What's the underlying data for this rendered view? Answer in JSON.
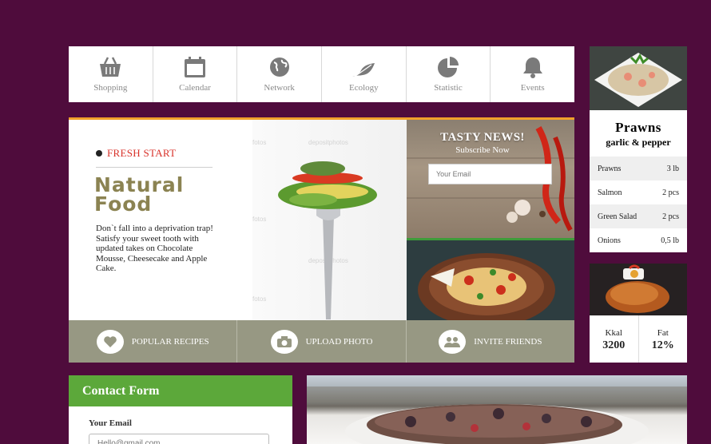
{
  "nav": {
    "items": [
      {
        "label": "Shopping",
        "icon": "basket-icon"
      },
      {
        "label": "Calendar",
        "icon": "calendar-icon"
      },
      {
        "label": "Network",
        "icon": "globe-icon"
      },
      {
        "label": "Ecology",
        "icon": "leaf-icon"
      },
      {
        "label": "Statistic",
        "icon": "pie-chart-icon"
      },
      {
        "label": "Events",
        "icon": "bell-icon"
      }
    ]
  },
  "hero": {
    "kicker": "FRESH START",
    "title_line1": "Natural",
    "title_line2": "Food",
    "description": "Don`t fall into a deprivation trap! Satisfy your sweet tooth with updated takes on Chocolate Mousse, Cheesecake and Apple Cake.",
    "watermarks": [
      "fotos",
      "depositphotos"
    ]
  },
  "subscribe": {
    "title": "TASTY NEWS!",
    "subtitle": "Subscribe Now",
    "placeholder": "Your Email"
  },
  "actions": [
    {
      "label": "POPULAR RECIPES",
      "icon": "heart-icon"
    },
    {
      "label": "UPLOAD PHOTO",
      "icon": "camera-icon"
    },
    {
      "label": "INVITE FRIENDS",
      "icon": "people-icon"
    }
  ],
  "recipe_card": {
    "title": "Prawns",
    "subtitle": "garlic & pepper",
    "ingredients": [
      {
        "name": "Prawns",
        "qty": "3 lb"
      },
      {
        "name": "Salmon",
        "qty": "2 pcs"
      },
      {
        "name": "Green Salad",
        "qty": "2 pcs"
      },
      {
        "name": "Onions",
        "qty": "0,5 lb"
      }
    ]
  },
  "nutrition_card": {
    "stats": [
      {
        "label": "Kkal",
        "value": "3200"
      },
      {
        "label": "Fat",
        "value": "12%"
      }
    ]
  },
  "contact": {
    "title": "Contact Form",
    "email_label": "Your Email",
    "email_placeholder": "Hello@gmail.com"
  },
  "colors": {
    "background": "#4f0c3c",
    "accent_green": "#5ca83a",
    "accent_red": "#d8322a",
    "title_olive": "#8b8352",
    "action_bar": "#979883"
  }
}
